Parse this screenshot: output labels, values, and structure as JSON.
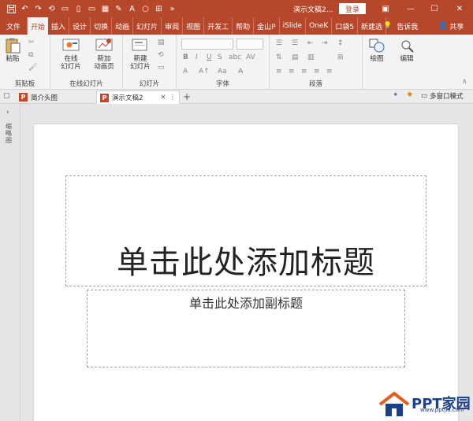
{
  "titlebar": {
    "doc_title": "演示文稿2...",
    "login_label": "登录",
    "icons": [
      "save-icon",
      "undo-icon",
      "redo-icon",
      "format-painter-icon",
      "print-preview-icon",
      "new-file-icon",
      "open-icon",
      "grid-icon",
      "pen-icon",
      "font-color-icon",
      "circle-icon",
      "crop-icon",
      "collapse-icon"
    ]
  },
  "tabs": [
    "文件",
    "开始",
    "插入",
    "设计",
    "切换",
    "动画",
    "幻灯片",
    "审阅",
    "视图",
    "开发工",
    "帮助",
    "金山P",
    "iSlide",
    "OneK",
    "口袋5",
    "新建选"
  ],
  "active_tab": "开始",
  "tell_me": "告诉我",
  "share": "共享",
  "ribbon": {
    "clipboard": {
      "paste": "粘贴",
      "label": "剪贴板"
    },
    "online_slides": {
      "btn1": "在线\n幻灯片",
      "btn1_a": "在线",
      "btn1_b": "幻灯片",
      "btn2_a": "新加",
      "btn2_b": "动画页",
      "label": "在线幻灯片"
    },
    "slides": {
      "new_a": "新建",
      "new_b": "幻灯片",
      "label": "幻灯片"
    },
    "font": {
      "label": "字体"
    },
    "paragraph": {
      "label": "段落"
    },
    "drawing": {
      "label": "绘图"
    },
    "editing": {
      "label": "编辑"
    }
  },
  "doctabs": [
    {
      "label": "简介头图",
      "active": false
    },
    {
      "label": "演示文稿2",
      "active": true
    }
  ],
  "multiwindow": "多窗口模式",
  "leftpane_label": "缩略图",
  "slide": {
    "title_placeholder": "单击此处添加标题",
    "subtitle_placeholder": "单击此处添加副标题"
  },
  "watermark": {
    "text": "PPT家园",
    "url": "www.pptjia.com"
  },
  "colors": {
    "accent": "#b7472a",
    "ribbon_bg": "#f3f3f3",
    "canvas_bg": "#e6e6e6"
  }
}
